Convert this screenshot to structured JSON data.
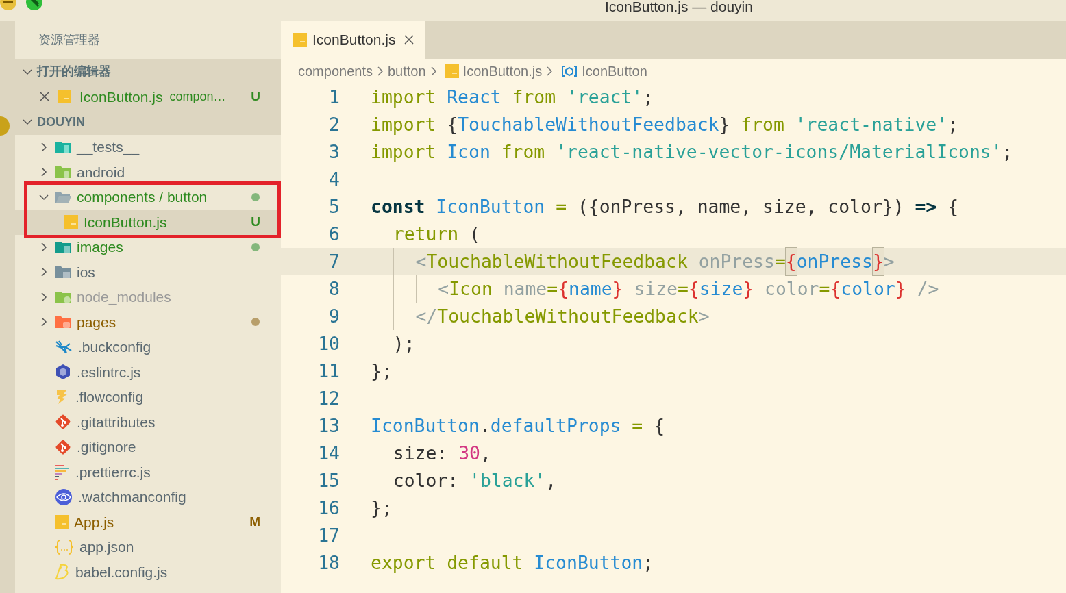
{
  "window": {
    "title": "IconButton.js — douyin"
  },
  "sidebar": {
    "title": "资源管理器",
    "open_editors": {
      "header": "打开的编辑器",
      "expanded": true,
      "items": [
        {
          "name": "IconButton.js",
          "description": "compon…",
          "badge": "U",
          "color": "#2d8a1f",
          "kind": "js",
          "selected": true
        }
      ]
    },
    "project": {
      "header": "DOUYIN",
      "expanded": true,
      "items": [
        {
          "name": "__tests__",
          "kind": "tests",
          "color": "#5a6870",
          "expanded": false,
          "selected": false
        },
        {
          "name": "android",
          "kind": "android",
          "color": "#5a6870",
          "expanded": false,
          "selected": false
        },
        {
          "name": "components / button",
          "kind": "folder",
          "color": "#2d8a1f",
          "dot": true,
          "expanded": true,
          "selected": false,
          "annotated": true,
          "children": [
            {
              "name": "IconButton.js",
              "kind": "js",
              "color": "#2d8a1f",
              "badge": "U",
              "selected": true
            }
          ]
        },
        {
          "name": "images",
          "kind": "images",
          "color": "#2d8a1f",
          "dot": true,
          "expanded": false,
          "selected": false
        },
        {
          "name": "ios",
          "kind": "ios",
          "color": "#5a6870",
          "expanded": false,
          "selected": false
        },
        {
          "name": "node_modules",
          "kind": "node",
          "color": "#999999",
          "expanded": false,
          "selected": false
        },
        {
          "name": "pages",
          "kind": "pages",
          "color": "#8c5e00",
          "dot": true,
          "expanded": false,
          "selected": false
        },
        {
          "name": ".buckconfig",
          "kind": "buck",
          "color": "#5a6870",
          "selected": false
        },
        {
          "name": ".eslintrc.js",
          "kind": "eslint",
          "color": "#5a6870",
          "selected": false
        },
        {
          "name": ".flowconfig",
          "kind": "flow",
          "color": "#5a6870",
          "selected": false
        },
        {
          "name": ".gitattributes",
          "kind": "git",
          "color": "#5a6870",
          "selected": false
        },
        {
          "name": ".gitignore",
          "kind": "git",
          "color": "#5a6870",
          "selected": false
        },
        {
          "name": ".prettierrc.js",
          "kind": "prettier",
          "color": "#5a6870",
          "selected": false
        },
        {
          "name": ".watchmanconfig",
          "kind": "watchman",
          "color": "#5a6870",
          "selected": false
        },
        {
          "name": "App.js",
          "kind": "js",
          "color": "#8c5e00",
          "badge": "M",
          "selected": false
        },
        {
          "name": "app.json",
          "kind": "json",
          "color": "#5a6870",
          "selected": false
        },
        {
          "name": "babel.config.js",
          "kind": "babel",
          "color": "#5a6870",
          "selected": false
        }
      ]
    }
  },
  "tabs": [
    {
      "label": "IconButton.js",
      "kind": "js",
      "selected": true
    }
  ],
  "breadcrumb": [
    {
      "text": "components"
    },
    {
      "text": "button"
    },
    {
      "text": "IconButton.js",
      "kind": "js"
    },
    {
      "text": "IconButton",
      "kind": "symbol"
    }
  ],
  "editor": {
    "lines": [
      {
        "number": "1",
        "current": false,
        "tokens": [
          {
            "kind": "kw",
            "text": "import "
          },
          {
            "kind": "var",
            "text": "React "
          },
          {
            "kind": "kw",
            "text": "from "
          },
          {
            "kind": "str",
            "text": "'react'"
          },
          {
            "kind": "plain",
            "text": ";"
          }
        ]
      },
      {
        "number": "2",
        "current": false,
        "tokens": [
          {
            "kind": "kw",
            "text": "import "
          },
          {
            "kind": "plain",
            "text": "{"
          },
          {
            "kind": "var",
            "text": "TouchableWithoutFeedback"
          },
          {
            "kind": "plain",
            "text": "} "
          },
          {
            "kind": "kw",
            "text": "from "
          },
          {
            "kind": "str",
            "text": "'react-native'"
          },
          {
            "kind": "plain",
            "text": ";"
          }
        ]
      },
      {
        "number": "3",
        "current": false,
        "tokens": [
          {
            "kind": "kw",
            "text": "import "
          },
          {
            "kind": "var",
            "text": "Icon "
          },
          {
            "kind": "kw",
            "text": "from "
          },
          {
            "kind": "str",
            "text": "'react-native-vector-icons/MaterialIcons'"
          },
          {
            "kind": "plain",
            "text": ";"
          }
        ]
      },
      {
        "number": "4",
        "current": false
      },
      {
        "number": "5",
        "current": false,
        "tokens": [
          {
            "kind": "storage",
            "text": "const "
          },
          {
            "kind": "var",
            "text": "IconButton "
          },
          {
            "kind": "op",
            "text": "= "
          },
          {
            "kind": "plain",
            "text": "({onPress, name, size, color}) "
          },
          {
            "kind": "storage",
            "text": "=> "
          },
          {
            "kind": "plain",
            "text": "{"
          }
        ]
      },
      {
        "number": "6",
        "current": false,
        "tokens": [
          {
            "kind": "kw",
            "text": "  return "
          },
          {
            "kind": "plain",
            "text": "("
          }
        ]
      },
      {
        "number": "7",
        "current": true,
        "tokens": [
          {
            "kind": "tagp",
            "text": "    <"
          },
          {
            "kind": "tag",
            "text": "TouchableWithoutFeedback "
          },
          {
            "kind": "attr",
            "text": "onPress"
          },
          {
            "kind": "op",
            "text": "="
          },
          {
            "kind": "bracematch",
            "text": "{"
          },
          {
            "kind": "var",
            "text": "onPress"
          },
          {
            "kind": "bracematch",
            "text": "}"
          },
          {
            "kind": "tagp",
            "text": ">"
          }
        ]
      },
      {
        "number": "8",
        "current": false,
        "tokens": [
          {
            "kind": "tagp",
            "text": "      <"
          },
          {
            "kind": "tag",
            "text": "Icon "
          },
          {
            "kind": "attr",
            "text": "name"
          },
          {
            "kind": "op",
            "text": "="
          },
          {
            "kind": "brace",
            "text": "{"
          },
          {
            "kind": "var",
            "text": "name"
          },
          {
            "kind": "brace",
            "text": "} "
          },
          {
            "kind": "attr",
            "text": "size"
          },
          {
            "kind": "op",
            "text": "="
          },
          {
            "kind": "brace",
            "text": "{"
          },
          {
            "kind": "var",
            "text": "size"
          },
          {
            "kind": "brace",
            "text": "} "
          },
          {
            "kind": "attr",
            "text": "color"
          },
          {
            "kind": "op",
            "text": "="
          },
          {
            "kind": "brace",
            "text": "{"
          },
          {
            "kind": "var",
            "text": "color"
          },
          {
            "kind": "brace",
            "text": "} "
          },
          {
            "kind": "tagp",
            "text": "/>"
          }
        ]
      },
      {
        "number": "9",
        "current": false,
        "tokens": [
          {
            "kind": "tagp",
            "text": "    </"
          },
          {
            "kind": "tag",
            "text": "TouchableWithoutFeedback"
          },
          {
            "kind": "tagp",
            "text": ">"
          }
        ]
      },
      {
        "number": "10",
        "current": false,
        "tokens": [
          {
            "kind": "plain",
            "text": "  );"
          }
        ]
      },
      {
        "number": "11",
        "current": false,
        "tokens": [
          {
            "kind": "plain",
            "text": "};"
          }
        ]
      },
      {
        "number": "12",
        "current": false
      },
      {
        "number": "13",
        "current": false,
        "tokens": [
          {
            "kind": "var",
            "text": "IconButton"
          },
          {
            "kind": "plain",
            "text": "."
          },
          {
            "kind": "var",
            "text": "defaultProps "
          },
          {
            "kind": "op",
            "text": "= "
          },
          {
            "kind": "plain",
            "text": "{"
          }
        ]
      },
      {
        "number": "14",
        "current": false,
        "tokens": [
          {
            "kind": "plain",
            "text": "  size: "
          },
          {
            "kind": "num",
            "text": "30"
          },
          {
            "kind": "plain",
            "text": ","
          }
        ]
      },
      {
        "number": "15",
        "current": false,
        "tokens": [
          {
            "kind": "plain",
            "text": "  color: "
          },
          {
            "kind": "str",
            "text": "'black'"
          },
          {
            "kind": "plain",
            "text": ","
          }
        ]
      },
      {
        "number": "16",
        "current": false,
        "tokens": [
          {
            "kind": "plain",
            "text": "};"
          }
        ]
      },
      {
        "number": "17",
        "current": false
      },
      {
        "number": "18",
        "current": false,
        "tokens": [
          {
            "kind": "kw",
            "text": "export "
          },
          {
            "kind": "kw",
            "text": "default "
          },
          {
            "kind": "var",
            "text": "IconButton"
          },
          {
            "kind": "plain",
            "text": ";"
          }
        ]
      }
    ]
  }
}
